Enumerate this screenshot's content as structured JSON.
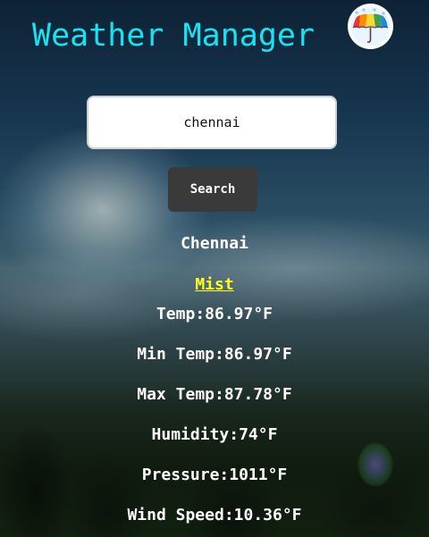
{
  "header": {
    "title": "Weather Manager",
    "logo_icon": "umbrella-icon"
  },
  "search": {
    "value": "chennai",
    "button_label": "Search"
  },
  "weather": {
    "city": "Chennai",
    "condition": "Mist",
    "stats": [
      {
        "label": "Temp",
        "value": "Temp:86.97°F"
      },
      {
        "label": "Min Temp",
        "value": "Min Temp:86.97°F"
      },
      {
        "label": "Max Temp",
        "value": "Max Temp:87.78°F"
      },
      {
        "label": "Humidity",
        "value": "Humidity:74°F"
      },
      {
        "label": "Pressure",
        "value": "Pressure:1011°F"
      },
      {
        "label": "Wind Speed",
        "value": "Wind Speed:10.36°F"
      }
    ]
  },
  "colors": {
    "title": "#16e4f2",
    "condition": "#ffff1a",
    "button_bg": "#3a3a3a",
    "text": "#ffffff"
  }
}
